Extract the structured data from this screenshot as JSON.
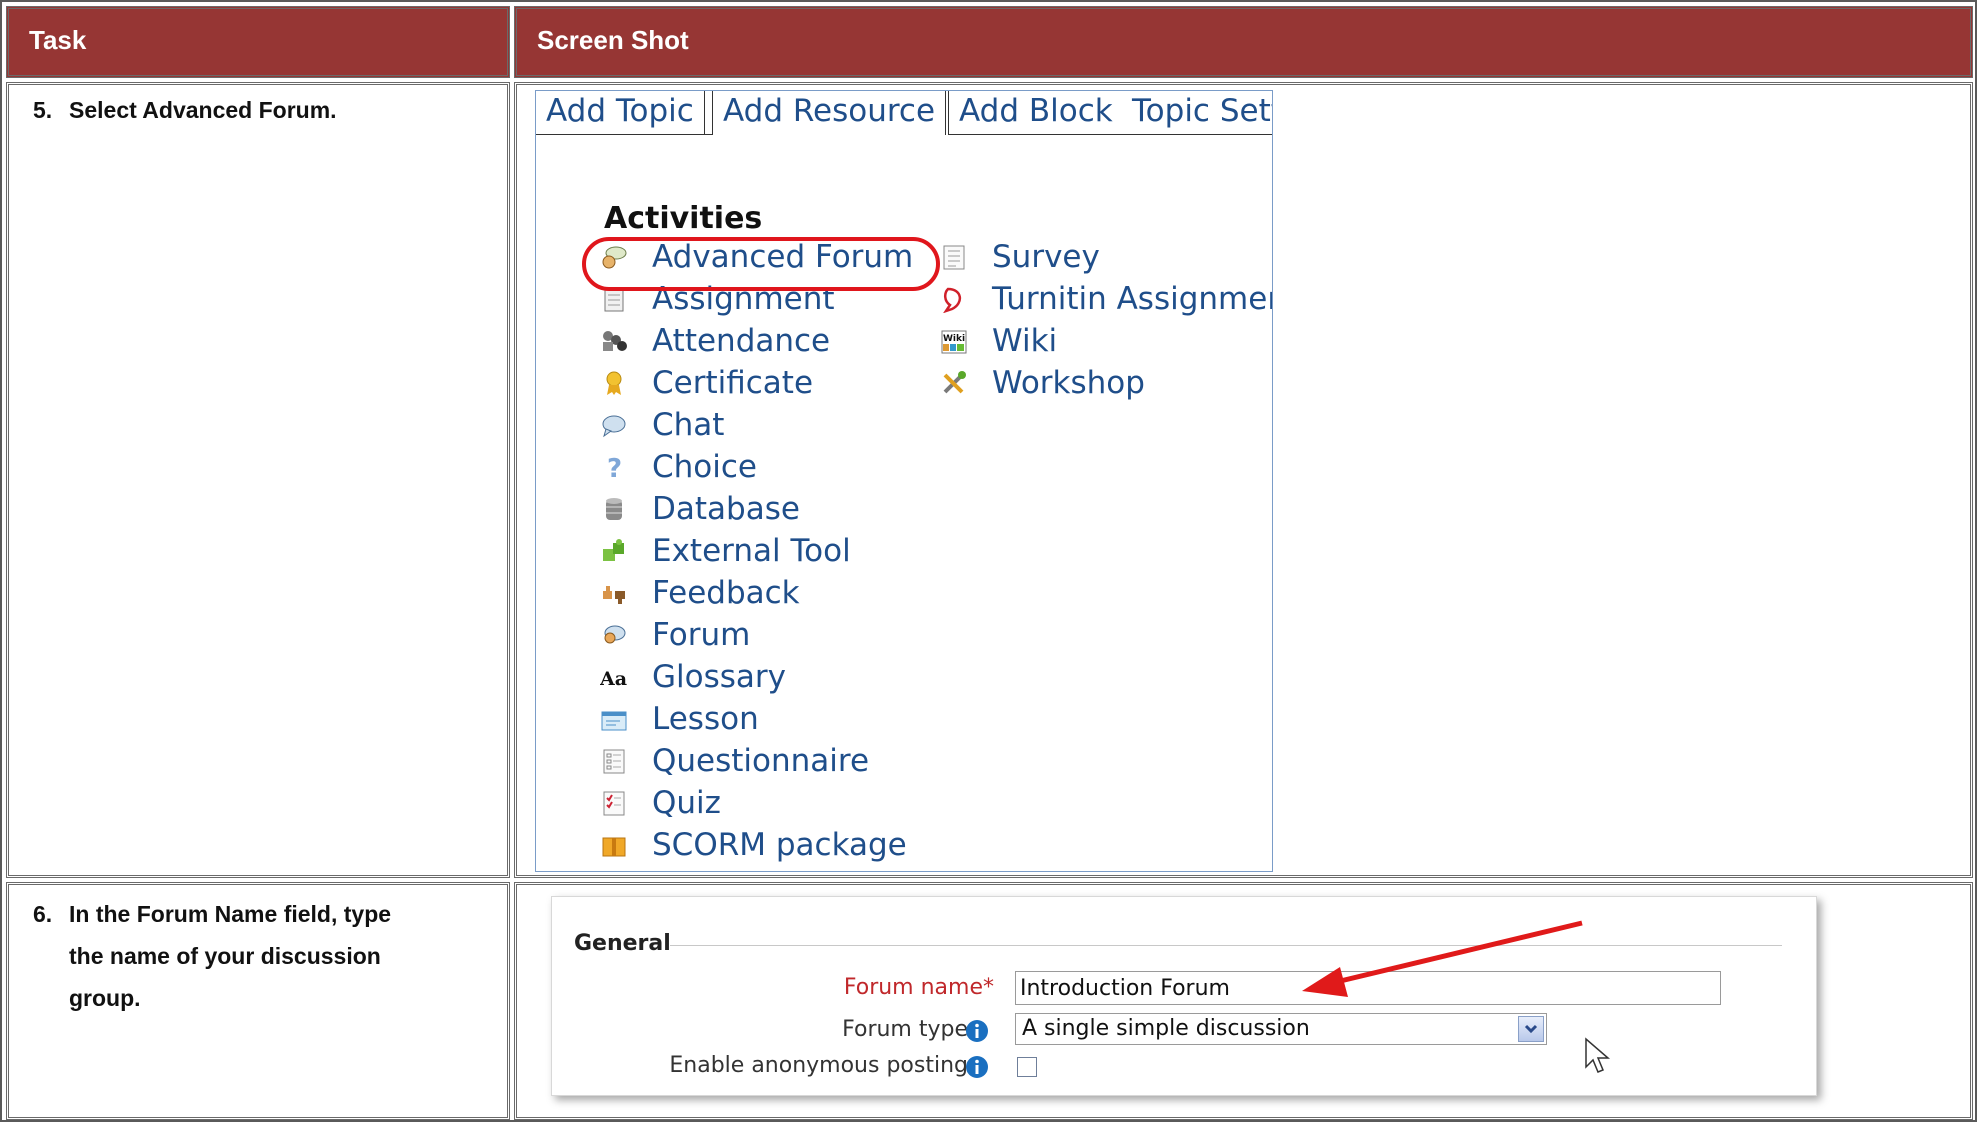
{
  "table": {
    "header_task": "Task",
    "header_screenshot": "Screen Shot",
    "rows": [
      {
        "num": "5.",
        "text": "Select Advanced Forum."
      },
      {
        "num": "6.",
        "lines": [
          "In the Forum Name field, type",
          "the name of your discussion",
          "group."
        ]
      }
    ]
  },
  "shot1": {
    "tabs": [
      "Add Topic",
      "Add Resource",
      "Add Block",
      "Topic Sett"
    ],
    "activities_heading": "Activities",
    "left_column": [
      {
        "label": "Advanced Forum",
        "icon": "advanced-forum-icon",
        "highlighted": true
      },
      {
        "label": "Assignment",
        "icon": "assignment-icon"
      },
      {
        "label": "Attendance",
        "icon": "attendance-icon"
      },
      {
        "label": "Certificate",
        "icon": "certificate-icon"
      },
      {
        "label": "Chat",
        "icon": "chat-icon"
      },
      {
        "label": "Choice",
        "icon": "choice-icon"
      },
      {
        "label": "Database",
        "icon": "database-icon"
      },
      {
        "label": "External Tool",
        "icon": "external-tool-icon"
      },
      {
        "label": "Feedback",
        "icon": "feedback-icon"
      },
      {
        "label": "Forum",
        "icon": "forum-icon"
      },
      {
        "label": "Glossary",
        "icon": "glossary-icon"
      },
      {
        "label": "Lesson",
        "icon": "lesson-icon"
      },
      {
        "label": "Questionnaire",
        "icon": "questionnaire-icon"
      },
      {
        "label": "Quiz",
        "icon": "quiz-icon"
      },
      {
        "label": "SCORM package",
        "icon": "scorm-package-icon"
      }
    ],
    "right_column": [
      {
        "label": "Survey",
        "icon": "survey-icon"
      },
      {
        "label": "Turnitin Assignment",
        "icon": "turnitin-icon"
      },
      {
        "label": "Wiki",
        "icon": "wiki-icon"
      },
      {
        "label": "Workshop",
        "icon": "workshop-icon"
      }
    ],
    "glossary_icon_text": "Aa",
    "wiki_icon_text": "Wiki"
  },
  "shot2": {
    "section": "General",
    "forum_name_label": "Forum name",
    "required_mark": "*",
    "forum_name_value": "Introduction Forum",
    "forum_type_label": "Forum type",
    "forum_type_value": "A single simple discussion",
    "anonymous_label": "Enable anonymous posting",
    "anonymous_checked": false
  },
  "colors": {
    "header_bg": "#963634",
    "link": "#1f4e8a",
    "highlight": "#e0161c"
  }
}
